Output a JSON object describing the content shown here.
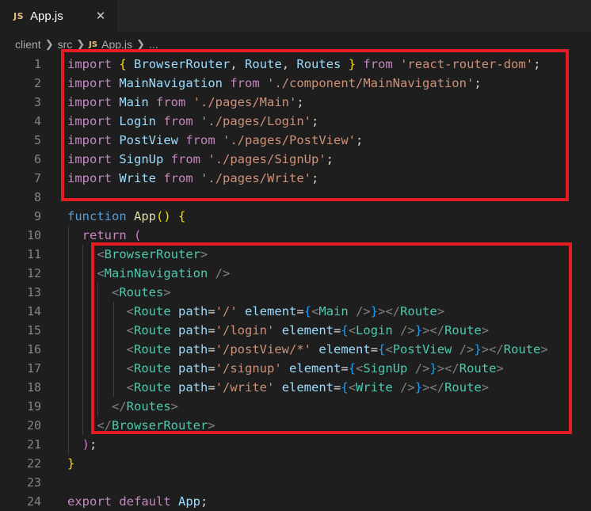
{
  "tab": {
    "icon_label": "JS",
    "title": "App.js",
    "close_glyph": "✕"
  },
  "breadcrumb": {
    "items": [
      "client",
      "src",
      "App.js",
      "..."
    ],
    "file_icon_label": "JS"
  },
  "colors": {
    "highlight_box": "#e51c23",
    "background": "#1e1e1e",
    "keyword": "#569cd6",
    "control": "#c586c0",
    "string": "#ce9178",
    "component": "#4ec9b0"
  },
  "lines": [
    {
      "n": "1",
      "tokens": [
        [
          "kwp",
          "import"
        ],
        [
          "punc",
          " "
        ],
        [
          "brY",
          "{"
        ],
        [
          "punc",
          " "
        ],
        [
          "id",
          "BrowserRouter"
        ],
        [
          "punc",
          ", "
        ],
        [
          "id",
          "Route"
        ],
        [
          "punc",
          ", "
        ],
        [
          "id",
          "Routes"
        ],
        [
          "punc",
          " "
        ],
        [
          "brY",
          "}"
        ],
        [
          "punc",
          " "
        ],
        [
          "kwp",
          "from"
        ],
        [
          "punc",
          " "
        ],
        [
          "str",
          "'react-router-dom'"
        ],
        [
          "punc",
          ";"
        ]
      ]
    },
    {
      "n": "2",
      "tokens": [
        [
          "kwp",
          "import"
        ],
        [
          "punc",
          " "
        ],
        [
          "id",
          "MainNavigation"
        ],
        [
          "punc",
          " "
        ],
        [
          "kwp",
          "from"
        ],
        [
          "punc",
          " "
        ],
        [
          "str",
          "'./component/MainNavigation'"
        ],
        [
          "punc",
          ";"
        ]
      ]
    },
    {
      "n": "3",
      "tokens": [
        [
          "kwp",
          "import"
        ],
        [
          "punc",
          " "
        ],
        [
          "id",
          "Main"
        ],
        [
          "punc",
          " "
        ],
        [
          "kwp",
          "from"
        ],
        [
          "punc",
          " "
        ],
        [
          "str",
          "'./pages/Main'"
        ],
        [
          "punc",
          ";"
        ]
      ]
    },
    {
      "n": "4",
      "tokens": [
        [
          "kwp",
          "import"
        ],
        [
          "punc",
          " "
        ],
        [
          "id",
          "Login"
        ],
        [
          "punc",
          " "
        ],
        [
          "kwp",
          "from"
        ],
        [
          "punc",
          " "
        ],
        [
          "str",
          "'./pages/Login'"
        ],
        [
          "punc",
          ";"
        ]
      ]
    },
    {
      "n": "5",
      "tokens": [
        [
          "kwp",
          "import"
        ],
        [
          "punc",
          " "
        ],
        [
          "id",
          "PostView"
        ],
        [
          "punc",
          " "
        ],
        [
          "kwp",
          "from"
        ],
        [
          "punc",
          " "
        ],
        [
          "str",
          "'./pages/PostView'"
        ],
        [
          "punc",
          ";"
        ]
      ]
    },
    {
      "n": "6",
      "tokens": [
        [
          "kwp",
          "import"
        ],
        [
          "punc",
          " "
        ],
        [
          "id",
          "SignUp"
        ],
        [
          "punc",
          " "
        ],
        [
          "kwp",
          "from"
        ],
        [
          "punc",
          " "
        ],
        [
          "str",
          "'./pages/SignUp'"
        ],
        [
          "punc",
          ";"
        ]
      ]
    },
    {
      "n": "7",
      "tokens": [
        [
          "kwp",
          "import"
        ],
        [
          "punc",
          " "
        ],
        [
          "id",
          "Write"
        ],
        [
          "punc",
          " "
        ],
        [
          "kwp",
          "from"
        ],
        [
          "punc",
          " "
        ],
        [
          "str",
          "'./pages/Write'"
        ],
        [
          "punc",
          ";"
        ]
      ]
    },
    {
      "n": "8",
      "tokens": []
    },
    {
      "n": "9",
      "tokens": [
        [
          "kw",
          "function"
        ],
        [
          "punc",
          " "
        ],
        [
          "fn",
          "App"
        ],
        [
          "brY",
          "()"
        ],
        [
          "punc",
          " "
        ],
        [
          "brY",
          "{"
        ]
      ]
    },
    {
      "n": "10",
      "tokens": [
        [
          "punc",
          "  "
        ],
        [
          "kwp",
          "return"
        ],
        [
          "punc",
          " "
        ],
        [
          "brP",
          "("
        ]
      ]
    },
    {
      "n": "11",
      "tokens": [
        [
          "punc",
          "    "
        ],
        [
          "ang",
          "<"
        ],
        [
          "tag",
          "BrowserRouter"
        ],
        [
          "ang",
          ">"
        ]
      ]
    },
    {
      "n": "12",
      "tokens": [
        [
          "punc",
          "    "
        ],
        [
          "ang",
          "<"
        ],
        [
          "tag",
          "MainNavigation"
        ],
        [
          "punc",
          " "
        ],
        [
          "ang",
          "/>"
        ]
      ]
    },
    {
      "n": "13",
      "tokens": [
        [
          "punc",
          "      "
        ],
        [
          "ang",
          "<"
        ],
        [
          "tag",
          "Routes"
        ],
        [
          "ang",
          ">"
        ]
      ]
    },
    {
      "n": "14",
      "tokens": [
        [
          "punc",
          "        "
        ],
        [
          "ang",
          "<"
        ],
        [
          "tag",
          "Route"
        ],
        [
          "punc",
          " "
        ],
        [
          "id",
          "path"
        ],
        [
          "punc",
          "="
        ],
        [
          "str",
          "'/'"
        ],
        [
          "punc",
          " "
        ],
        [
          "id",
          "element"
        ],
        [
          "punc",
          "="
        ],
        [
          "brB",
          "{"
        ],
        [
          "ang",
          "<"
        ],
        [
          "tag",
          "Main"
        ],
        [
          "punc",
          " "
        ],
        [
          "ang",
          "/>"
        ],
        [
          "brB",
          "}"
        ],
        [
          "ang",
          "></"
        ],
        [
          "tag",
          "Route"
        ],
        [
          "ang",
          ">"
        ]
      ]
    },
    {
      "n": "15",
      "tokens": [
        [
          "punc",
          "        "
        ],
        [
          "ang",
          "<"
        ],
        [
          "tag",
          "Route"
        ],
        [
          "punc",
          " "
        ],
        [
          "id",
          "path"
        ],
        [
          "punc",
          "="
        ],
        [
          "str",
          "'/login'"
        ],
        [
          "punc",
          " "
        ],
        [
          "id",
          "element"
        ],
        [
          "punc",
          "="
        ],
        [
          "brB",
          "{"
        ],
        [
          "ang",
          "<"
        ],
        [
          "tag",
          "Login"
        ],
        [
          "punc",
          " "
        ],
        [
          "ang",
          "/>"
        ],
        [
          "brB",
          "}"
        ],
        [
          "ang",
          "></"
        ],
        [
          "tag",
          "Route"
        ],
        [
          "ang",
          ">"
        ]
      ]
    },
    {
      "n": "16",
      "tokens": [
        [
          "punc",
          "        "
        ],
        [
          "ang",
          "<"
        ],
        [
          "tag",
          "Route"
        ],
        [
          "punc",
          " "
        ],
        [
          "id",
          "path"
        ],
        [
          "punc",
          "="
        ],
        [
          "str",
          "'/postView/*'"
        ],
        [
          "punc",
          " "
        ],
        [
          "id",
          "element"
        ],
        [
          "punc",
          "="
        ],
        [
          "brB",
          "{"
        ],
        [
          "ang",
          "<"
        ],
        [
          "tag",
          "PostView"
        ],
        [
          "punc",
          " "
        ],
        [
          "ang",
          "/>"
        ],
        [
          "brB",
          "}"
        ],
        [
          "ang",
          "></"
        ],
        [
          "tag",
          "Route"
        ],
        [
          "ang",
          ">"
        ]
      ]
    },
    {
      "n": "17",
      "tokens": [
        [
          "punc",
          "        "
        ],
        [
          "ang",
          "<"
        ],
        [
          "tag",
          "Route"
        ],
        [
          "punc",
          " "
        ],
        [
          "id",
          "path"
        ],
        [
          "punc",
          "="
        ],
        [
          "str",
          "'/signup'"
        ],
        [
          "punc",
          " "
        ],
        [
          "id",
          "element"
        ],
        [
          "punc",
          "="
        ],
        [
          "brB",
          "{"
        ],
        [
          "ang",
          "<"
        ],
        [
          "tag",
          "SignUp"
        ],
        [
          "punc",
          " "
        ],
        [
          "ang",
          "/>"
        ],
        [
          "brB",
          "}"
        ],
        [
          "ang",
          "></"
        ],
        [
          "tag",
          "Route"
        ],
        [
          "ang",
          ">"
        ]
      ]
    },
    {
      "n": "18",
      "tokens": [
        [
          "punc",
          "        "
        ],
        [
          "ang",
          "<"
        ],
        [
          "tag",
          "Route"
        ],
        [
          "punc",
          " "
        ],
        [
          "id",
          "path"
        ],
        [
          "punc",
          "="
        ],
        [
          "str",
          "'/write'"
        ],
        [
          "punc",
          " "
        ],
        [
          "id",
          "element"
        ],
        [
          "punc",
          "="
        ],
        [
          "brB",
          "{"
        ],
        [
          "ang",
          "<"
        ],
        [
          "tag",
          "Write"
        ],
        [
          "punc",
          " "
        ],
        [
          "ang",
          "/>"
        ],
        [
          "brB",
          "}"
        ],
        [
          "ang",
          "></"
        ],
        [
          "tag",
          "Route"
        ],
        [
          "ang",
          ">"
        ]
      ]
    },
    {
      "n": "19",
      "tokens": [
        [
          "punc",
          "      "
        ],
        [
          "ang",
          "</"
        ],
        [
          "tag",
          "Routes"
        ],
        [
          "ang",
          ">"
        ]
      ]
    },
    {
      "n": "20",
      "tokens": [
        [
          "punc",
          "    "
        ],
        [
          "ang",
          "</"
        ],
        [
          "tag",
          "BrowserRouter"
        ],
        [
          "ang",
          ">"
        ]
      ]
    },
    {
      "n": "21",
      "tokens": [
        [
          "punc",
          "  "
        ],
        [
          "brP",
          ")"
        ],
        [
          "punc",
          ";"
        ]
      ]
    },
    {
      "n": "22",
      "tokens": [
        [
          "brY",
          "}"
        ]
      ]
    },
    {
      "n": "23",
      "tokens": []
    },
    {
      "n": "24",
      "tokens": [
        [
          "kwp",
          "export"
        ],
        [
          "punc",
          " "
        ],
        [
          "kwp",
          "default"
        ],
        [
          "punc",
          " "
        ],
        [
          "id",
          "App"
        ],
        [
          "punc",
          ";"
        ]
      ]
    }
  ]
}
